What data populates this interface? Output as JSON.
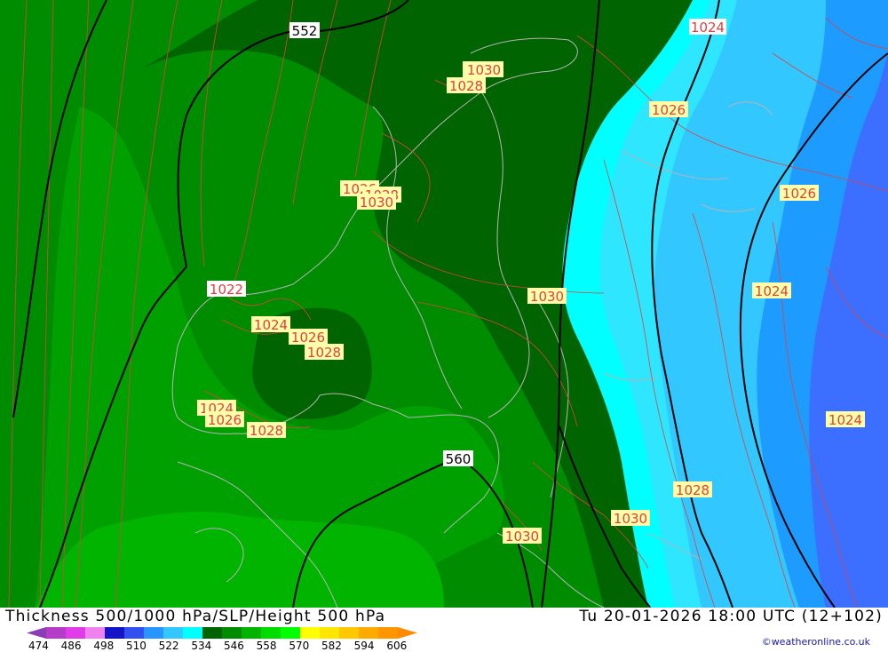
{
  "title": {
    "product": "Thickness 500/1000 hPa/SLP/Height 500 hPa",
    "valid_time": "Tu 20-01-2026 18:00 UTC (12+102)"
  },
  "credit": "©weatheronline.co.uk",
  "colors": {
    "green_dark": "#006400",
    "green_mid": "#008c00",
    "green_light": "#00b400",
    "cyan": "#00ffff",
    "cyan_light": "#2ee6ff",
    "blue_light": "#32c8ff",
    "blue_mid": "#1e9bff",
    "blue_deep": "#3c6eff",
    "isobar": "#e04040",
    "height_contour": "#000000",
    "coastline": "#b4b4b4"
  },
  "scale": {
    "labels": [
      "474",
      "486",
      "498",
      "510",
      "522",
      "534",
      "546",
      "558",
      "570",
      "582",
      "594",
      "606"
    ],
    "colors": [
      "#8c3cb4",
      "#b43cc8",
      "#e03ce8",
      "#f082f0",
      "#1414c8",
      "#3250f0",
      "#2896ff",
      "#32c8ff",
      "#00ffff",
      "#006400",
      "#008c00",
      "#00b400",
      "#00dc00",
      "#00ff00",
      "#ffff00",
      "#ffe600",
      "#ffc800",
      "#ffaa00",
      "#ff9600",
      "#ff8c00"
    ]
  },
  "height_labels": [
    "552",
    "560"
  ],
  "isobar_labels": [
    "1024",
    "1026",
    "1030",
    "1028",
    "1026",
    "1028",
    "1030",
    "1022",
    "1024",
    "1026",
    "1028",
    "1024",
    "1026",
    "1028",
    "1030",
    "1026",
    "1024",
    "1024",
    "1028",
    "1030",
    "1030"
  ]
}
